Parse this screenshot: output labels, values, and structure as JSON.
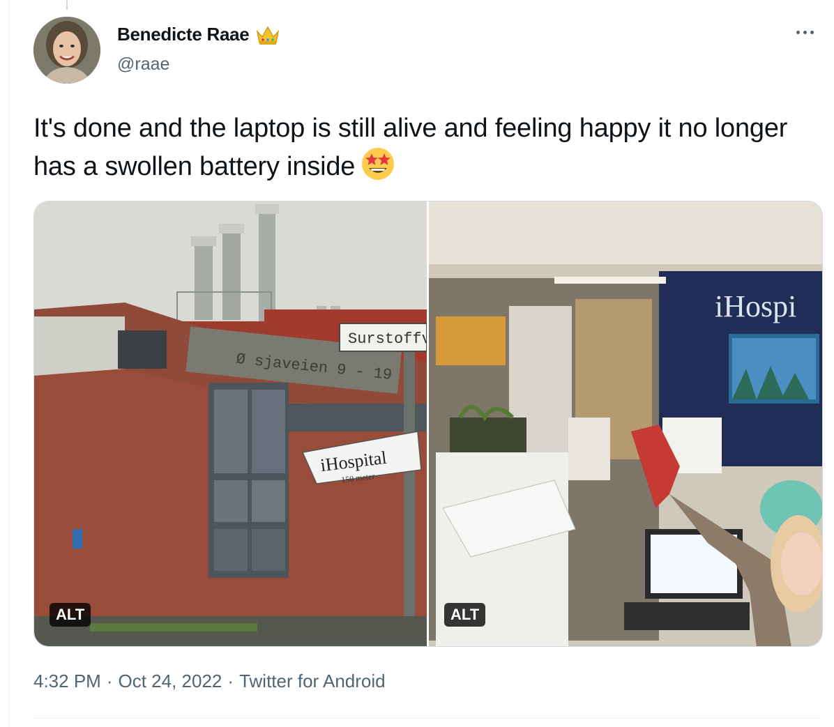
{
  "tweet": {
    "display_name": "Benedicte Raae",
    "name_emoji": "crown-emoji",
    "handle": "@raae",
    "text": "It's done and the laptop is still alive and feeling happy it no longer has a swollen battery inside",
    "text_emoji": "star-struck-emoji",
    "media": [
      {
        "alt_label": "ALT",
        "sign_top": "Surstoffv",
        "sign_street": "Ø    sjaveien  9 - 19",
        "sign_arrow": "iHospital",
        "sign_arrow_sub": "150 meter"
      },
      {
        "alt_label": "ALT",
        "wall_logo": "iHospi"
      }
    ],
    "time": "4:32 PM",
    "separator": "·",
    "date": "Oct 24, 2022",
    "source": "Twitter for Android"
  },
  "colors": {
    "text": "#0f1419",
    "secondary": "#536471",
    "border": "#cfd9de",
    "crown": "#f4c430"
  }
}
